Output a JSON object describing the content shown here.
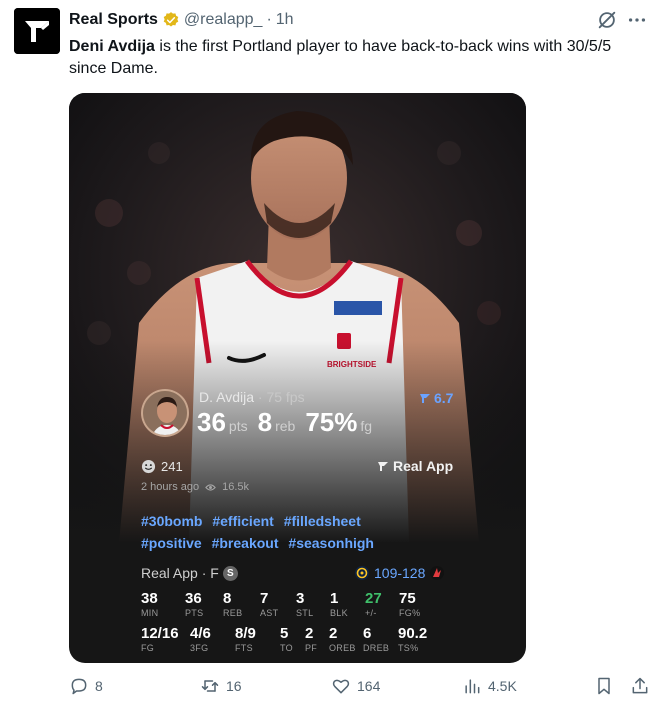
{
  "author": {
    "name": "Real Sports",
    "handle": "@realapp_",
    "separator": "·",
    "time": "1h"
  },
  "tweet": {
    "bold_name": "Deni Avdija",
    "body": " is the first Portland player to have back-to-back wins with 30/5/5 since Dame."
  },
  "card": {
    "player_short": "D. Avdija",
    "fps": "· 75 fps",
    "rating": "6.7",
    "stats": [
      {
        "value": "36",
        "unit": "pts"
      },
      {
        "value": "8",
        "unit": "reb"
      },
      {
        "value": "75%",
        "unit": "fg"
      }
    ],
    "reactions": "241",
    "brand": "Real App",
    "posted_ago": "2 hours ago",
    "views": "16.5k",
    "hashtags": [
      "#30bomb",
      "#efficient",
      "#filledsheet",
      "#positive",
      "#breakout",
      "#seasonhigh"
    ],
    "game_label": "Real App · F",
    "pos_badge": "S",
    "score": "109-128",
    "row1": [
      {
        "v": "38",
        "l": "MIN"
      },
      {
        "v": "36",
        "l": "PTS"
      },
      {
        "v": "8",
        "l": "REB"
      },
      {
        "v": "7",
        "l": "AST"
      },
      {
        "v": "3",
        "l": "STL"
      },
      {
        "v": "1",
        "l": "BLK"
      },
      {
        "v": "27",
        "l": "+/-"
      },
      {
        "v": "75",
        "l": "FG%"
      }
    ],
    "row2": [
      {
        "v": "12/16",
        "l": "FG"
      },
      {
        "v": "4/6",
        "l": "3FG"
      },
      {
        "v": "8/9",
        "l": "FTS"
      },
      {
        "v": "5",
        "l": "TO"
      },
      {
        "v": "2",
        "l": "PF"
      },
      {
        "v": "2",
        "l": "OREB"
      },
      {
        "v": "6",
        "l": "DREB"
      },
      {
        "v": "90.2",
        "l": "TS%"
      }
    ]
  },
  "actions": {
    "replies": "8",
    "reposts": "16",
    "likes": "164",
    "views": "4.5K"
  },
  "colors": {
    "accent_blue": "#6aa7ff",
    "green": "#3fbf6a",
    "verified_gold": "#e2b719"
  },
  "icons": [
    "logo-icon",
    "verified-icon",
    "grok-icon",
    "more-icon",
    "reply-icon",
    "repost-icon",
    "like-icon",
    "views-icon",
    "bookmark-icon",
    "share-icon"
  ]
}
